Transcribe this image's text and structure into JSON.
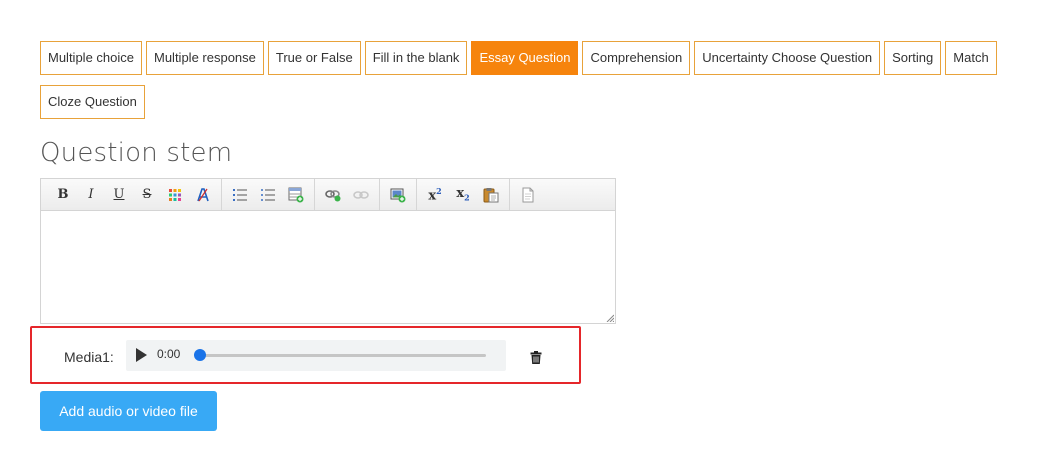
{
  "question_types": [
    {
      "label": "Multiple choice",
      "active": false
    },
    {
      "label": "Multiple response",
      "active": false
    },
    {
      "label": "True or False",
      "active": false
    },
    {
      "label": "Fill in the blank",
      "active": false
    },
    {
      "label": "Essay Question",
      "active": true
    },
    {
      "label": "Comprehension",
      "active": false
    },
    {
      "label": "Uncertainty Choose Question",
      "active": false
    },
    {
      "label": "Sorting",
      "active": false
    },
    {
      "label": "Match",
      "active": false
    },
    {
      "label": "Cloze Question",
      "active": false
    }
  ],
  "editor": {
    "title": "Question stem",
    "toolbar": {
      "bold": "B",
      "italic": "I",
      "underline": "U",
      "strike": "S",
      "superscript_base": "x",
      "superscript_mark": "2",
      "subscript_base": "x",
      "subscript_mark": "2"
    },
    "content": ""
  },
  "media": {
    "label": "Media1:",
    "time": "0:00",
    "progress": 0
  },
  "add_button": "Add audio or video file",
  "colors": {
    "accent": "#f6840d",
    "tab_border": "#e8a23a",
    "button": "#38a9f5",
    "highlight_border": "#e5262a"
  }
}
